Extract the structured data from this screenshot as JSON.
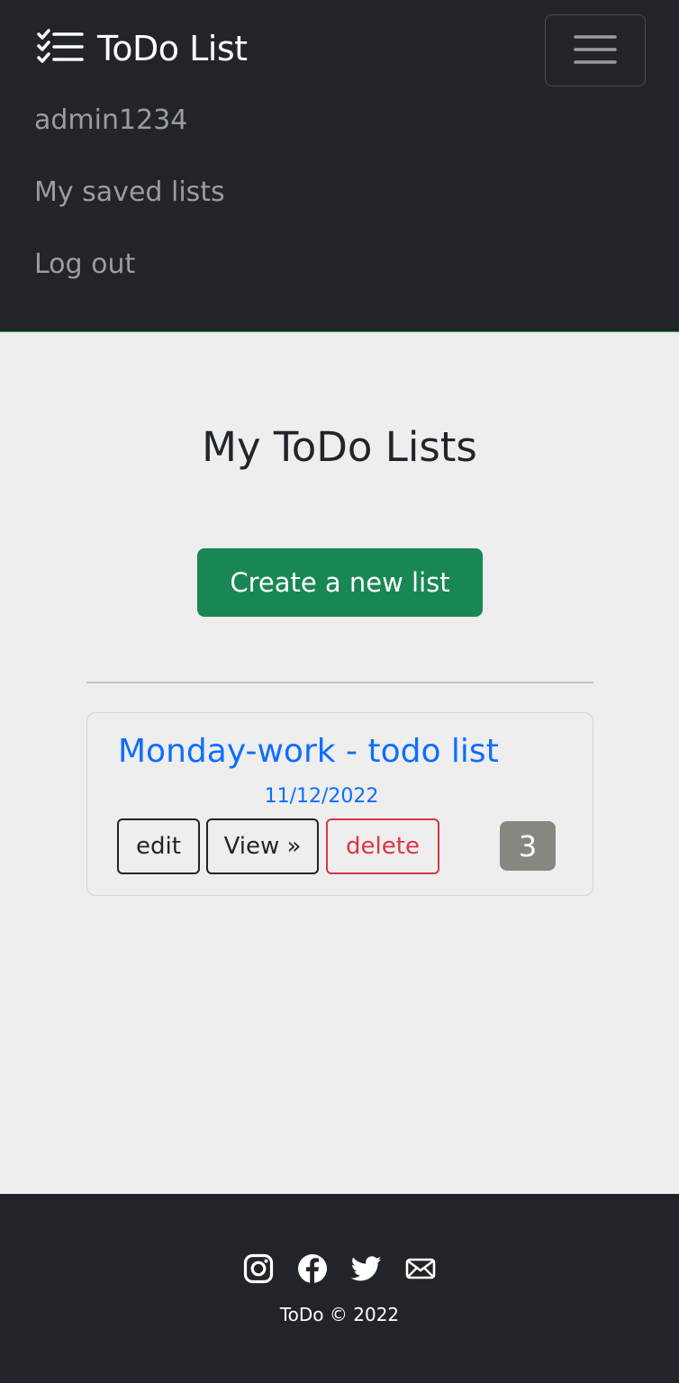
{
  "navbar": {
    "brand": "ToDo List",
    "brand_icon": "checklist-icon",
    "toggler_icon": "hamburger-icon",
    "links": [
      "admin1234",
      "My saved lists",
      "Log out"
    ]
  },
  "main": {
    "title": "My ToDo Lists",
    "create_button": "Create a new list"
  },
  "lists": [
    {
      "title": "Monday-work - todo list",
      "date": "11/12/2022",
      "edit": "edit",
      "view": "View »",
      "delete": "delete",
      "count": "3"
    }
  ],
  "footer": {
    "icons": [
      "instagram-icon",
      "facebook-icon",
      "twitter-icon",
      "envelope-icon"
    ],
    "copyright": "ToDo © 2022"
  },
  "colors": {
    "navbar_bg": "#212529",
    "page_bg": "#eeeeee",
    "primary": "#0d6efd",
    "success": "#198754",
    "danger": "#dc3545",
    "badge": "#878782"
  }
}
